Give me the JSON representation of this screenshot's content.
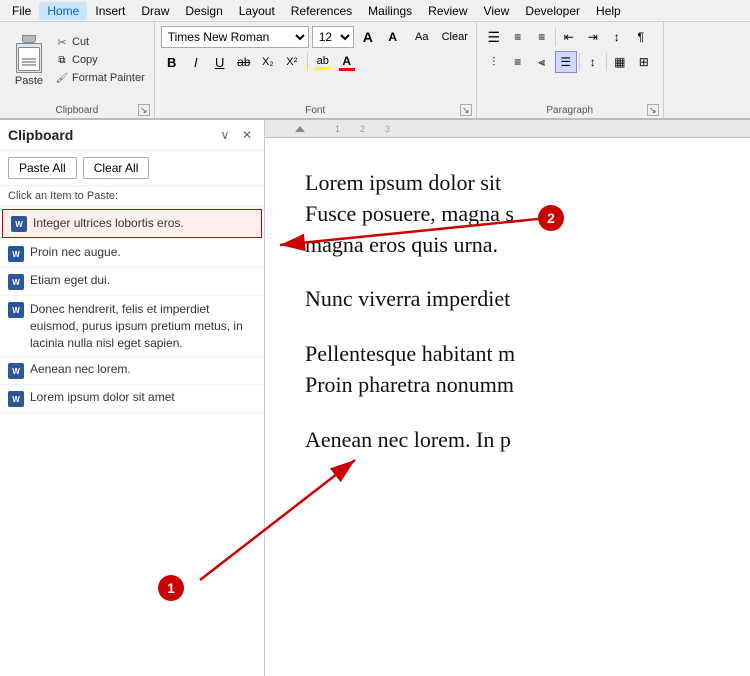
{
  "menubar": {
    "items": [
      "File",
      "Home",
      "Insert",
      "Draw",
      "Design",
      "Layout",
      "References",
      "Mailings",
      "Review",
      "View",
      "Developer",
      "Help"
    ],
    "active": "Home"
  },
  "ribbon": {
    "clipboard": {
      "label": "Clipboard",
      "paste": "Paste",
      "cut": "Cut",
      "copy": "Copy",
      "format_painter": "Format Painter"
    },
    "font": {
      "label": "Font",
      "font_name": "Times New Roman",
      "font_size": "12",
      "grow": "A",
      "shrink": "A",
      "case": "Aa",
      "clear": "Clear",
      "bold": "B",
      "italic": "I",
      "underline": "U",
      "strikethrough": "ab",
      "subscript": "X",
      "superscript": "X",
      "text_color": "A",
      "highlight": "ab",
      "font_color": "A"
    },
    "paragraph": {
      "label": "Paragraph"
    }
  },
  "clipboard_panel": {
    "title": "Clipboard",
    "paste_all": "Paste All",
    "clear_all": "Clear All",
    "hint": "Click an Item to Paste:",
    "items": [
      {
        "id": 1,
        "text": "Integer ultrices lobortis eros.",
        "selected": true
      },
      {
        "id": 2,
        "text": "Proin nec augue."
      },
      {
        "id": 3,
        "text": "Etiam eget dui."
      },
      {
        "id": 4,
        "text": "Donec hendrerit, felis et imperdiet euismod, purus ipsum pretium metus, in lacinia nulla nisl eget sapien."
      },
      {
        "id": 5,
        "text": "Aenean nec lorem."
      },
      {
        "id": 6,
        "text": "Lorem ipsum dolor sit amet"
      }
    ]
  },
  "document": {
    "paragraphs": [
      "Lorem ipsum dolor sit\nFusce posuere, magna s\nmagna eros quis urna.",
      "Nunc viverra imperdiet",
      "Pellentesque habitant m\nProin pharetra nonumm",
      "Aenean nec lorem. In p"
    ]
  },
  "annotations": {
    "circle1": "1",
    "circle2": "2"
  }
}
